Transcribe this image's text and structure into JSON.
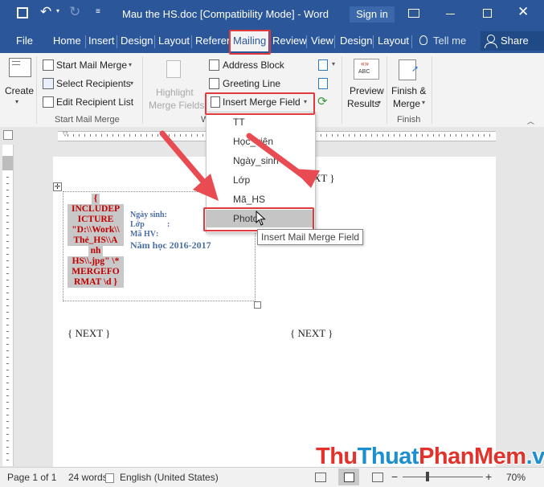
{
  "window": {
    "title": "Mau the HS.doc [Compatibility Mode]  -  Word",
    "sign_in": "Sign in"
  },
  "tabs": [
    "File",
    "Home",
    "Insert",
    "Design",
    "Layout",
    "Referen",
    "Mailing",
    "Review",
    "View",
    "Design",
    "Layout"
  ],
  "tell_me": "Tell me",
  "share": "Share",
  "ribbon": {
    "create": "Create",
    "start_mail_merge": "Start Mail Merge",
    "select_recipients": "Select Recipients",
    "edit_recipient_list": "Edit Recipient List",
    "group_start": "Start Mail Merge",
    "highlight_merge_fields_1": "Highlight",
    "highlight_merge_fields_2": "Merge Fields",
    "group_write_w": "W",
    "address_block": "Address Block",
    "greeting_line": "Greeting Line",
    "insert_merge_field": "Insert Merge Field",
    "preview_results_1": "Preview",
    "preview_results_2": "Results",
    "preview_abc": "ABC",
    "finish_merge_1": "Finish &",
    "finish_merge_2": "Merge",
    "group_finish": "Finish"
  },
  "merge_fields": [
    "TT",
    "Học_viên",
    "Ngày_sinh",
    "Lớp",
    "Mã_HS",
    "Photo"
  ],
  "tooltip": "Insert Mail Merge Field",
  "document": {
    "next_top_right": "XT }",
    "field_code_lines": [
      "{",
      "INCLUDEP",
      "ICTURE",
      "\"D:\\\\Work\\\\",
      "Thẻ_HS\\\\A",
      "nh",
      "HS\\\\.jpg\" \\*",
      "MERGEFO",
      "RMAT \\d }"
    ],
    "label_ngay_sinh": "Ngày sinh:",
    "label_lop": "Lớp",
    "label_ma_hv": "Mã HV",
    "colon": ":",
    "nam_hoc": "Năm học 2016-2017",
    "next_left": "{ NEXT }",
    "next_right": "{ NEXT }"
  },
  "status": {
    "page": "Page 1 of 1",
    "words": "24 words",
    "language": "English (United States)",
    "zoom": "70%",
    "zoom_minus": "−",
    "zoom_plus": "+"
  },
  "watermark": {
    "part1": "Thu",
    "part2": "Thuat",
    "part3": "PhanMem",
    "part4": ".vn"
  },
  "colors": {
    "word_blue": "#2b579a",
    "highlight_red": "#e0393e",
    "field_text_red": "#c00000",
    "field_bg_gray": "#c8c8c8",
    "label_blue": "#4a6fa5"
  }
}
